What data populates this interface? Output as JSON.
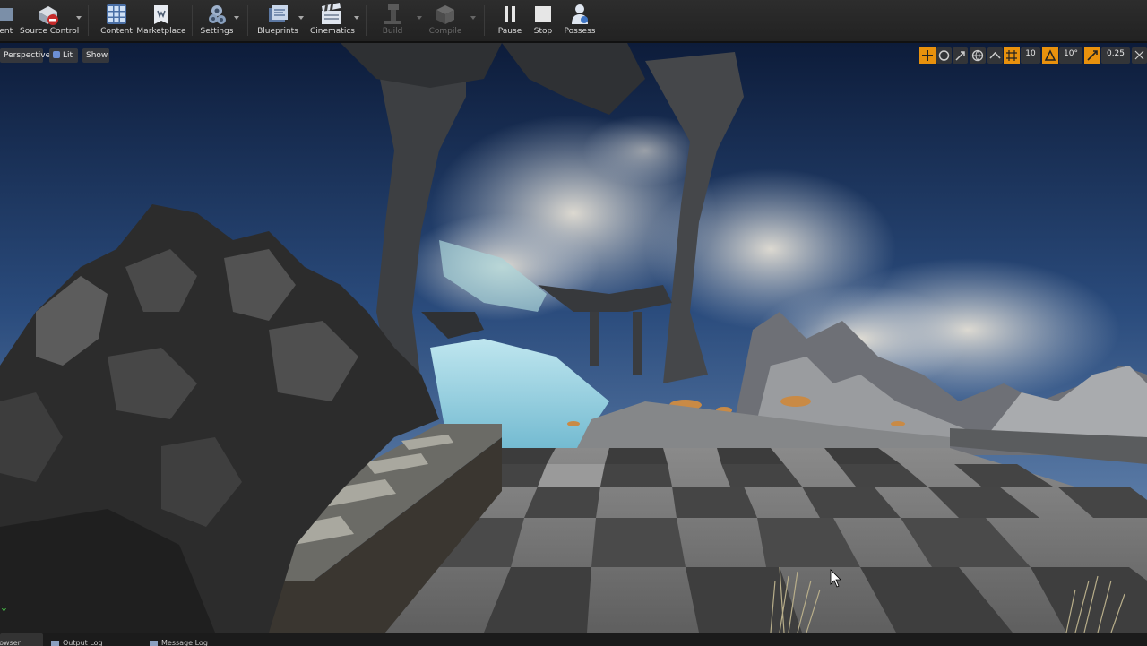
{
  "toolbar": {
    "items": [
      {
        "label": "rent",
        "icon": "current-level-icon",
        "dropdown": false
      },
      {
        "label": "Source Control",
        "icon": "source-control-icon",
        "dropdown": true
      },
      {
        "label": "Content",
        "icon": "content-browser-icon",
        "dropdown": false
      },
      {
        "label": "Marketplace",
        "icon": "marketplace-icon",
        "dropdown": false
      },
      {
        "label": "Settings",
        "icon": "settings-icon",
        "dropdown": true
      },
      {
        "label": "Blueprints",
        "icon": "blueprints-icon",
        "dropdown": true
      },
      {
        "label": "Cinematics",
        "icon": "cinematics-icon",
        "dropdown": true
      },
      {
        "label": "Build",
        "icon": "build-icon",
        "dropdown": true,
        "disabled": true
      },
      {
        "label": "Compile",
        "icon": "compile-icon",
        "dropdown": true,
        "disabled": true
      },
      {
        "label": "Pause",
        "icon": "pause-icon",
        "dropdown": false
      },
      {
        "label": "Stop",
        "icon": "stop-icon",
        "dropdown": false
      },
      {
        "label": "Possess",
        "icon": "possess-icon",
        "dropdown": false
      }
    ]
  },
  "viewport": {
    "left_buttons": {
      "perspective": "Perspective",
      "lit": "Lit",
      "show": "Show"
    },
    "right_controls": {
      "grid_snap": "10",
      "rotation_snap": "10°",
      "scale_snap": "0.25"
    },
    "axis_indicator": "Y"
  },
  "bottom_tabs": {
    "content_browser": "rowser",
    "output_log": "Output Log",
    "message_log": "Message Log"
  },
  "colors": {
    "toolbar_bg": "#262626",
    "accent_orange": "#e8910d",
    "sky_top": "#0d1c3a",
    "sky_bottom": "#6e8fb8"
  }
}
